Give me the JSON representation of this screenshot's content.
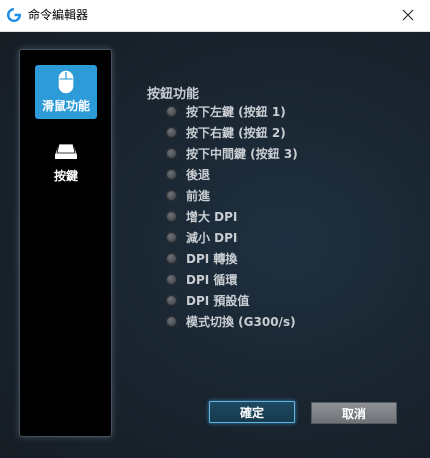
{
  "window": {
    "title": "命令編輯器",
    "logo_icon": "logitech-g-icon",
    "close_icon": "close-icon",
    "accent": "#2e9bd9"
  },
  "sidebar": {
    "tabs": [
      {
        "label": "滑鼠功能",
        "icon": "mouse-icon",
        "active": true
      },
      {
        "label": "按鍵",
        "icon": "key-icon",
        "active": false
      }
    ]
  },
  "main": {
    "section_title": "按鈕功能",
    "options": [
      "按下左鍵 (按鈕 1)",
      "按下右鍵 (按鈕 2)",
      "按下中間鍵 (按鈕 3)",
      "後退",
      "前進",
      "增大 DPI",
      "減小 DPI",
      "DPI 轉換",
      "DPI 循環",
      "DPI 預設值",
      "模式切換 (G300/s)"
    ]
  },
  "footer": {
    "ok_label": "確定",
    "cancel_label": "取消"
  }
}
